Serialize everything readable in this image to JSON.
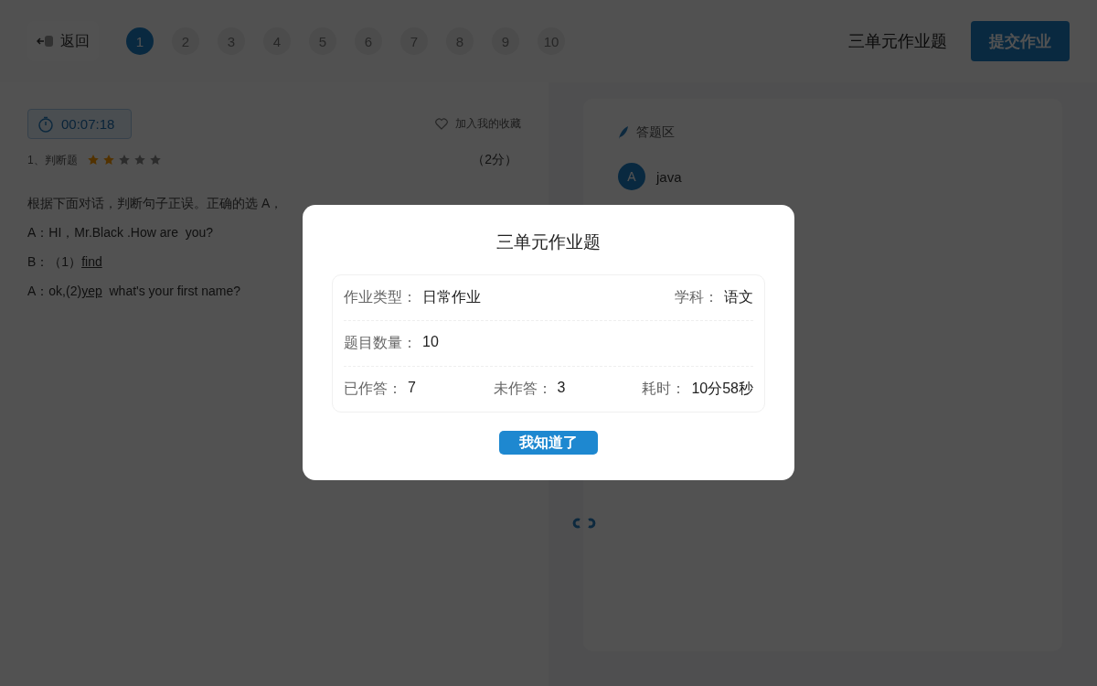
{
  "header": {
    "back_label": "返回",
    "question_numbers": [
      {
        "label": "1",
        "selected": true
      },
      {
        "label": "2",
        "selected": false
      },
      {
        "label": "3",
        "selected": false
      },
      {
        "label": "4",
        "selected": false
      },
      {
        "label": "5",
        "selected": false
      },
      {
        "label": "6",
        "selected": false
      },
      {
        "label": "7",
        "selected": false
      },
      {
        "label": "8",
        "selected": false
      },
      {
        "label": "9",
        "selected": false
      },
      {
        "label": "10",
        "selected": false
      }
    ],
    "title": "三单元作业题",
    "submit_label": "提交作业"
  },
  "question": {
    "timer": "00:07:18",
    "favorite_label": "加入我的收藏",
    "type_label": "1、判断题",
    "stars": 2,
    "score": "（2分）",
    "instruction": "根据下面对话，判断句子正误。正确的选 A，",
    "lines": [
      [
        {
          "kind": "text",
          "text": "A：HI，Mr.Black .How are  you?"
        }
      ],
      [
        {
          "kind": "text",
          "text": "B：（1）"
        },
        {
          "kind": "blank",
          "text": "find"
        }
      ],
      [
        {
          "kind": "text",
          "text": "A：ok,(2)"
        },
        {
          "kind": "blank",
          "text": "yep"
        },
        {
          "kind": "text",
          "text": "  what's your first name?"
        }
      ]
    ]
  },
  "answer_area": {
    "heading": "答题区",
    "options": [
      {
        "letter": "A",
        "text": "java"
      }
    ]
  },
  "dialog": {
    "title": "三单元作业题",
    "rows": [
      [
        {
          "label": "作业类型：",
          "value": "日常作业"
        },
        {},
        {
          "label": "学科：",
          "value": "语文"
        }
      ],
      [
        {
          "label": "题目数量：",
          "value": "10"
        }
      ],
      [
        {
          "label": "已作答：",
          "value": "7"
        },
        {
          "label": "未作答：",
          "value": "3"
        },
        {
          "label": "耗时：",
          "value": "10分58秒"
        }
      ]
    ],
    "button_label": "我知道了"
  }
}
